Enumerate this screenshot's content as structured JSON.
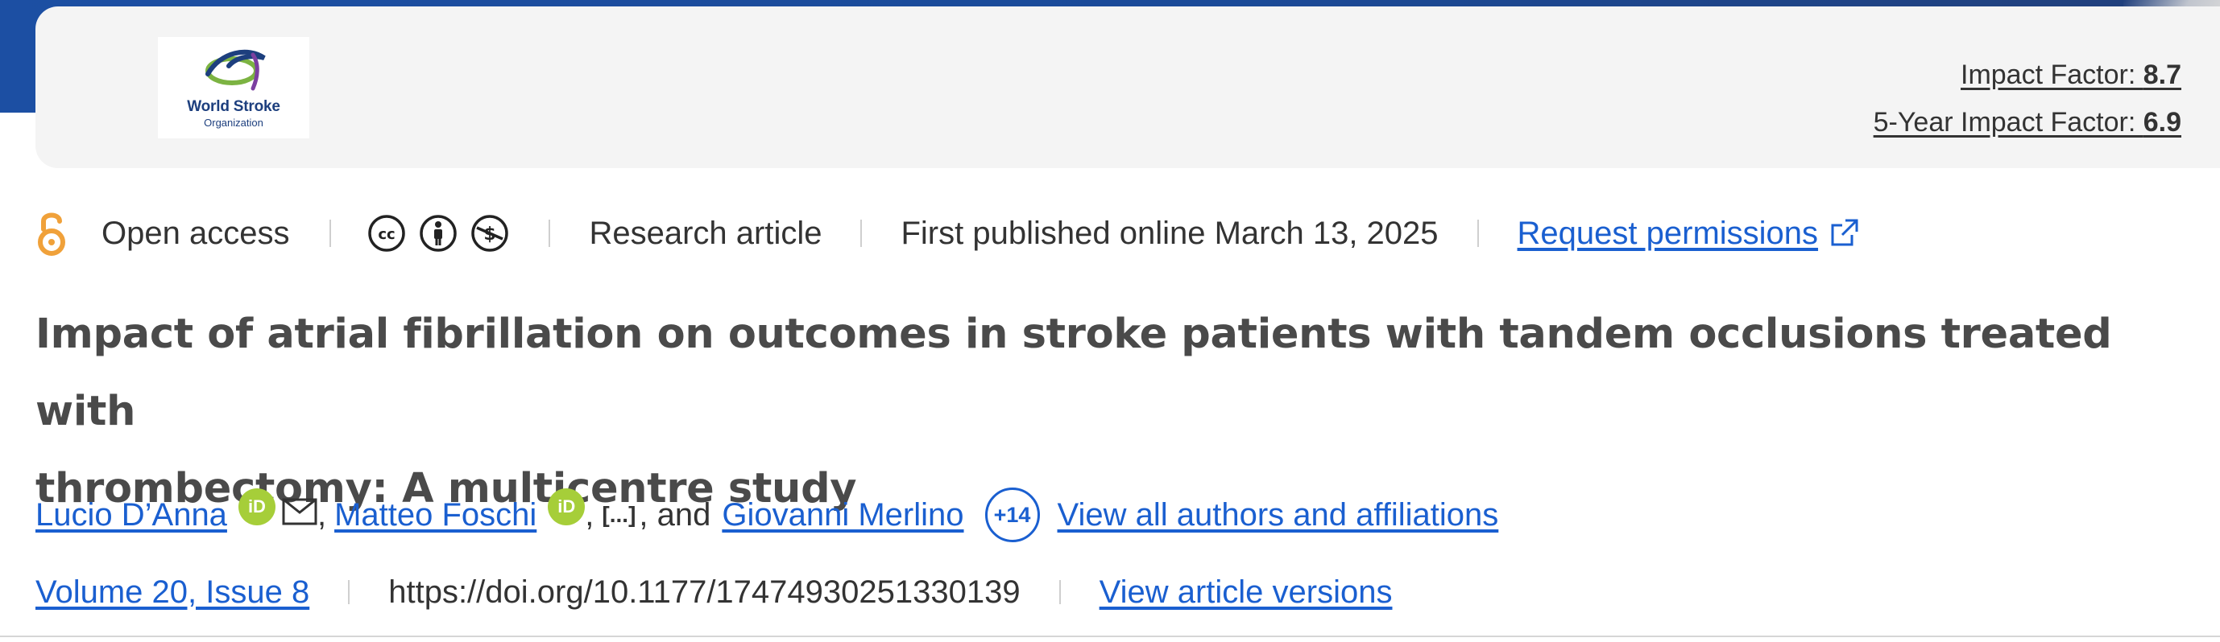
{
  "header": {
    "logo": {
      "name": "World Stroke",
      "sub": "Organization",
      "icon": "world-stroke-logo"
    },
    "impact_factor_label": "Impact Factor: ",
    "impact_factor_value": "8.7",
    "five_year_label": "5-Year Impact Factor: ",
    "five_year_value": "6.9"
  },
  "meta": {
    "open_access": "Open access",
    "license_icons": [
      "cc-icon",
      "attribution-icon",
      "noncommercial-icon"
    ],
    "article_type": "Research article",
    "published": "First published online March 13, 2025",
    "permissions_link": "Request permissions"
  },
  "article": {
    "title_line1": "Impact of atrial fibrillation on outcomes in stroke patients with tandem occlusions treated with",
    "title_line2": "thrombectomy: A multicentre study"
  },
  "authors": {
    "author1": "Lucio D’Anna",
    "author2": "Matteo Foschi",
    "comma": ",",
    "ellipsis": "[...]",
    "and_text": ", and",
    "author3": "Giovanni Merlino",
    "orcid_label": "iD",
    "more_count": "+14",
    "view_all": "View all authors and affiliations"
  },
  "volume": {
    "issue_link": "Volume 20, Issue 8",
    "doi": "https://doi.org/10.1177/17474930251330139",
    "versions_link": "View article versions"
  },
  "colors": {
    "link": "#1a5fd0",
    "open_access": "#f0a13a",
    "orcid": "#a6ce39",
    "title": "#4a4a4a",
    "band": "#1c4fa3"
  }
}
